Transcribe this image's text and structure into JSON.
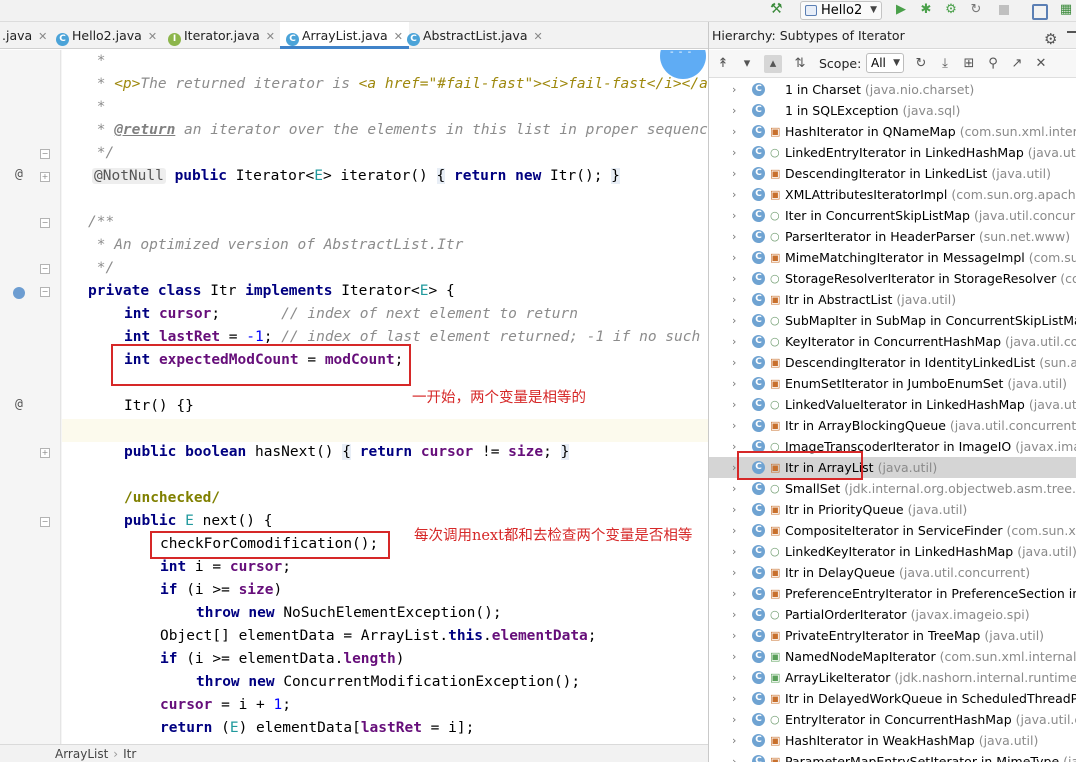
{
  "toolbar": {
    "run_config": "Hello2",
    "icons": [
      "hammer-icon",
      "run-icon",
      "debug-icon",
      "coverage-icon",
      "profile-icon",
      "stop-icon",
      "sdk-icon",
      "run-window-icon"
    ]
  },
  "tabs": [
    {
      "label": ".java",
      "icon": "",
      "active": false
    },
    {
      "label": "Hello2.java",
      "icon": "C",
      "icon_color": "#4ba3d8",
      "active": false
    },
    {
      "label": "Iterator.java",
      "icon": "I",
      "icon_color": "#8cb54b",
      "active": false
    },
    {
      "label": "ArrayList.java",
      "icon": "C",
      "icon_color": "#4ba3d8",
      "active": true
    },
    {
      "label": "AbstractList.java",
      "icon": "C",
      "icon_color": "#4ba3d8",
      "active": false
    }
  ],
  "editor": {
    "doc1": {
      "star": " *",
      "p1": "<p>",
      "text1": "The returned iterator is ",
      "href": "<a href=\"#fail-fast\"><i>fail-fast</i></a>"
    },
    "doc2": " *",
    "doc3": {
      "star": " * ",
      "tag": "@return",
      "text": " an iterator over the elements in this list in proper sequence"
    },
    "doc4": " */",
    "line_iterator": {
      "annotation": "@NotNull",
      "kw1": "public",
      "type": "Iterator<",
      "gen": "E",
      "rest": "> iterator() ",
      "brace_open": "{",
      "ret": "return",
      "new": "new",
      "call": " Itr(); ",
      "brace_close": "}"
    },
    "doc5": "/**",
    "doc6": " * An optimized version of AbstractList.Itr",
    "doc7": " */",
    "line_class": {
      "kw1": "private",
      "kw2": "class",
      "name": " Itr ",
      "kw3": "implements",
      "iface": " Iterator<",
      "gen": "E",
      "tail": "> {"
    },
    "line_cursor": {
      "kw": "int",
      "field": "cursor",
      "semi": ";",
      "comment": "// index of next element to return"
    },
    "line_lastret": {
      "kw": "int",
      "field": "lastRet",
      "assign": " = ",
      "num": "-1",
      "semi": ";",
      "comment": "// index of last element returned; -1 if no such"
    },
    "line_expected": {
      "kw": "int",
      "field": "expectedModCount",
      "assign": " = ",
      "mod": "modCount",
      "semi": ";"
    },
    "line_ctor": "Itr() {}",
    "line_hasnext": {
      "kw1": "public",
      "kw2": "boolean",
      "name": " hasNext() ",
      "brace_open": "{",
      "ret": "return",
      "f1": "cursor",
      "op": " != ",
      "f2": "size",
      "semi": "; ",
      "brace_close": "}"
    },
    "line_unchecked": "/unchecked/",
    "line_next": {
      "kw": "public",
      "gen": "E",
      "rest": " next() {"
    },
    "line_check": "checkForComodification();",
    "line_i": {
      "kw": "int",
      "rest": " i = ",
      "field": "cursor",
      "semi": ";"
    },
    "line_if1": {
      "kw": "if",
      "rest": " (i >= ",
      "field": "size",
      "tail": ")"
    },
    "line_throw1": {
      "kw1": "throw",
      "kw2": "new",
      "rest": " NoSuchElementException();"
    },
    "line_obj": {
      "type": "Object[] elementData = ArrayList.",
      "kw": "this",
      "dot": ".",
      "field": "elementData",
      "semi": ";"
    },
    "line_if2": {
      "kw": "if",
      "rest": " (i >= elementData.",
      "field": "length",
      "tail": ")"
    },
    "line_throw2": {
      "kw1": "throw",
      "kw2": "new",
      "rest": " ConcurrentModificationException();"
    },
    "line_cursor_inc": {
      "field": "cursor",
      "rest": " = i + ",
      "num": "1",
      "semi": ";"
    },
    "line_return": {
      "kw": "return",
      "open": " (",
      "gen": "E",
      "mid": ") elementData[",
      "field": "lastRet",
      "tail": " = i];"
    }
  },
  "notes": {
    "note1": "一开始，两个变量是相等的",
    "note2": "每次调用next都和去检查两个变量是否相等"
  },
  "breadcrumb": [
    "ArrayList",
    "Itr"
  ],
  "hierarchy": {
    "title": "Hierarchy:",
    "subtitle": "Subtypes of Iterator",
    "scope_label": "Scope:",
    "scope_value": "All",
    "items": [
      {
        "name": "1 in Charset",
        "pkg": "(java.nio.charset)",
        "vis": "none"
      },
      {
        "name": "1 in SQLException",
        "pkg": "(java.sql)",
        "vis": "none"
      },
      {
        "name": "HashIterator in QNameMap",
        "pkg": "(com.sun.xml.internal.",
        "vis": "lock"
      },
      {
        "name": "LinkedEntryIterator in LinkedHashMap",
        "pkg": "(java.util)",
        "vis": "dot"
      },
      {
        "name": "DescendingIterator in LinkedList",
        "pkg": "(java.util)",
        "vis": "lock"
      },
      {
        "name": "XMLAttributesIteratorImpl",
        "pkg": "(com.sun.org.apache.xe",
        "vis": "lock"
      },
      {
        "name": "Iter in ConcurrentSkipListMap",
        "pkg": "(java.util.concurrent)",
        "vis": "dot"
      },
      {
        "name": "ParserIterator in HeaderParser",
        "pkg": "(sun.net.www)",
        "vis": "dot"
      },
      {
        "name": "MimeMatchingIterator in MessageImpl",
        "pkg": "(com.sun.x",
        "vis": "lock"
      },
      {
        "name": "StorageResolverIterator in StorageResolver",
        "pkg": "(com.s",
        "vis": "dot"
      },
      {
        "name": "Itr in AbstractList",
        "pkg": "(java.util)",
        "vis": "lock"
      },
      {
        "name": "SubMapIter in SubMap in ConcurrentSkipListMap",
        "pkg": "",
        "vis": "dot"
      },
      {
        "name": "KeyIterator in ConcurrentHashMap",
        "pkg": "(java.util.concu",
        "vis": "dot"
      },
      {
        "name": "DescendingIterator in IdentityLinkedList",
        "pkg": "(sun.awt.ut",
        "vis": "lock"
      },
      {
        "name": "EnumSetIterator in JumboEnumSet",
        "pkg": "(java.util)",
        "vis": "lock"
      },
      {
        "name": "LinkedValueIterator in LinkedHashMap",
        "pkg": "(java.util)",
        "vis": "dot"
      },
      {
        "name": "Itr in ArrayBlockingQueue",
        "pkg": "(java.util.concurrent)",
        "vis": "lock"
      },
      {
        "name": "ImageTranscoderIterator in ImageIO",
        "pkg": "(javax.image",
        "vis": "dot"
      },
      {
        "name": "Itr in ArrayList",
        "pkg": "(java.util)",
        "vis": "lock",
        "selected": true
      },
      {
        "name": "SmallSet",
        "pkg": "(jdk.internal.org.objectweb.asm.tree.analy",
        "vis": "dot"
      },
      {
        "name": "Itr in PriorityQueue",
        "pkg": "(java.util)",
        "vis": "lock"
      },
      {
        "name": "CompositeIterator in ServiceFinder",
        "pkg": "(com.sun.xml.in",
        "vis": "lock"
      },
      {
        "name": "LinkedKeyIterator in LinkedHashMap",
        "pkg": "(java.util)",
        "vis": "dot"
      },
      {
        "name": "Itr in DelayQueue",
        "pkg": "(java.util.concurrent)",
        "vis": "lock"
      },
      {
        "name": "PreferenceEntryIterator in PreferenceSection in Op",
        "pkg": "",
        "vis": "lock"
      },
      {
        "name": "PartialOrderIterator",
        "pkg": "(javax.imageio.spi)",
        "vis": "dot"
      },
      {
        "name": "PrivateEntryIterator in TreeMap",
        "pkg": "(java.util)",
        "vis": "lock"
      },
      {
        "name": "NamedNodeMapIterator",
        "pkg": "(com.sun.xml.internal.ws.",
        "vis": "lockg"
      },
      {
        "name": "ArrayLikeIterator",
        "pkg": "(jdk.nashorn.internal.runtime.arra",
        "vis": "lockg"
      },
      {
        "name": "Itr in DelayedWorkQueue in ScheduledThreadPool",
        "pkg": "",
        "vis": "lock"
      },
      {
        "name": "EntryIterator in ConcurrentHashMap",
        "pkg": "(java.util.conc",
        "vis": "dot"
      },
      {
        "name": "HashIterator in WeakHashMap",
        "pkg": "(java.util)",
        "vis": "lock"
      },
      {
        "name": "ParameterMapEntrySetIterator in MimeType",
        "pkg": "(javax",
        "vis": "lock"
      }
    ]
  }
}
